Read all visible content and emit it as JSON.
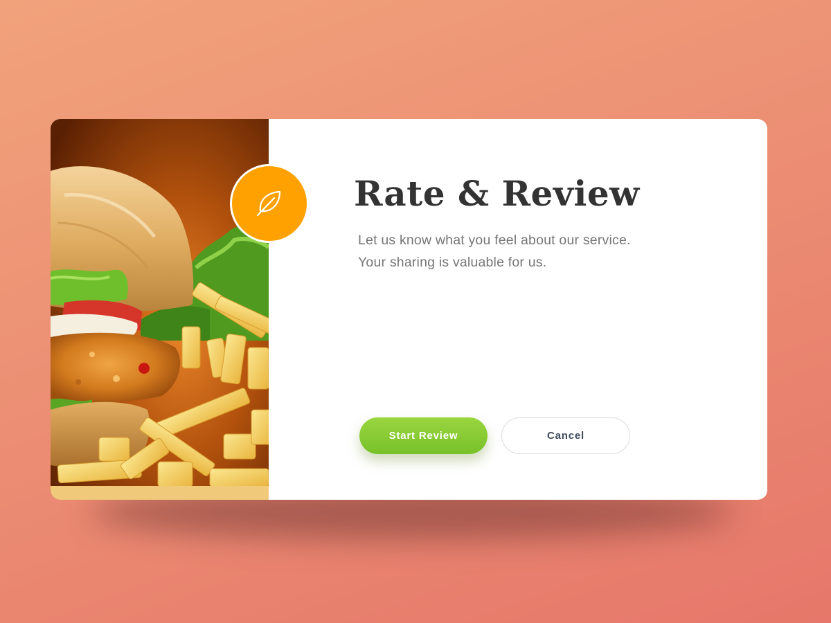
{
  "dialog": {
    "title": "Rate & Review",
    "description_line1": "Let us know what you feel about our service.",
    "description_line2": "Your sharing is valuable for us.",
    "badge_icon": "leaf-icon",
    "image_subject": "burger-and-fries-photo"
  },
  "actions": {
    "start_label": "Start Review",
    "cancel_label": "Cancel"
  },
  "colors": {
    "badge": "#ffa100",
    "primary_button": "#85c832",
    "title_text": "#333333",
    "body_text": "#767676"
  }
}
